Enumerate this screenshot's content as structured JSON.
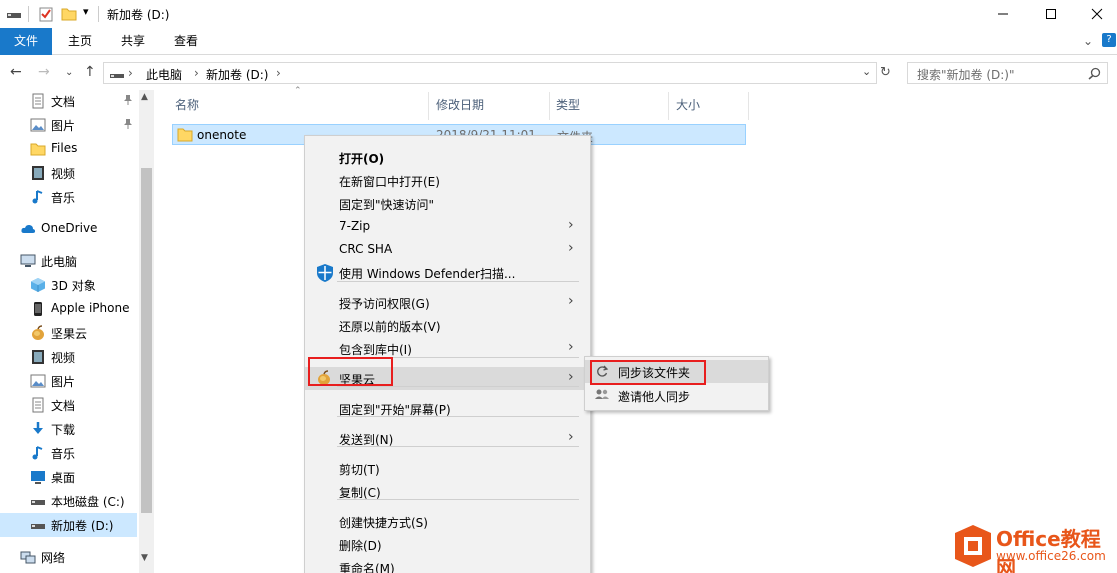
{
  "window": {
    "title": "新加卷 (D:)",
    "controls": [
      "minimize",
      "maximize",
      "close"
    ]
  },
  "ribbon": {
    "tabs": [
      "文件",
      "主页",
      "共享",
      "查看"
    ]
  },
  "address": {
    "crumbs": [
      "此电脑",
      "新加卷 (D:)"
    ],
    "search_placeholder": "搜索\"新加卷 (D:)\""
  },
  "sidebar": {
    "items": [
      {
        "label": "文档",
        "icon": "document-icon",
        "pinned": true
      },
      {
        "label": "图片",
        "icon": "picture-icon",
        "pinned": true
      },
      {
        "label": "Files",
        "icon": "folder-icon"
      },
      {
        "label": "视频",
        "icon": "video-icon"
      },
      {
        "label": "音乐",
        "icon": "music-icon"
      },
      {
        "label": "OneDrive",
        "icon": "cloud-icon"
      },
      {
        "label": "此电脑",
        "icon": "computer-icon"
      },
      {
        "label": "3D 对象",
        "icon": "cube-icon"
      },
      {
        "label": "Apple iPhone",
        "icon": "phone-icon"
      },
      {
        "label": "坚果云",
        "icon": "nut-icon"
      },
      {
        "label": "视频",
        "icon": "video-icon"
      },
      {
        "label": "图片",
        "icon": "picture-icon"
      },
      {
        "label": "文档",
        "icon": "document-icon"
      },
      {
        "label": "下载",
        "icon": "download-icon"
      },
      {
        "label": "音乐",
        "icon": "music-icon"
      },
      {
        "label": "桌面",
        "icon": "desktop-icon"
      },
      {
        "label": "本地磁盘 (C:)",
        "icon": "drive-icon"
      },
      {
        "label": "新加卷 (D:)",
        "icon": "drive-icon",
        "selected": true
      },
      {
        "label": "网络",
        "icon": "network-icon"
      }
    ]
  },
  "content": {
    "columns": [
      "名称",
      "修改日期",
      "类型",
      "大小"
    ],
    "files": [
      {
        "name": "onenote",
        "date": "2018/9/21 11:01",
        "type": "文件夹"
      }
    ]
  },
  "context_menu": {
    "items": [
      {
        "label": "打开(O)",
        "bold": true
      },
      {
        "label": "在新窗口中打开(E)"
      },
      {
        "label": "固定到\"快速访问\""
      },
      {
        "label": "7-Zip",
        "submenu": true
      },
      {
        "label": "CRC SHA",
        "submenu": true
      },
      {
        "label": "使用 Windows Defender扫描...",
        "icon": "shield-icon"
      },
      {
        "label": "授予访问权限(G)",
        "submenu": true
      },
      {
        "label": "还原以前的版本(V)"
      },
      {
        "label": "包含到库中(I)",
        "submenu": true
      },
      {
        "label": "坚果云",
        "submenu": true,
        "icon": "nut-icon",
        "highlighted": true
      },
      {
        "label": "固定到\"开始\"屏幕(P)"
      },
      {
        "label": "发送到(N)",
        "submenu": true
      },
      {
        "label": "剪切(T)"
      },
      {
        "label": "复制(C)"
      },
      {
        "label": "创建快捷方式(S)"
      },
      {
        "label": "删除(D)"
      },
      {
        "label": "重命名(M)"
      }
    ]
  },
  "submenu": {
    "items": [
      {
        "label": "同步该文件夹",
        "icon": "sync-icon"
      },
      {
        "label": "邀请他人同步",
        "icon": "people-icon"
      }
    ]
  },
  "watermark": {
    "brand": "Office教程网",
    "url": "www.office26.com"
  },
  "colors": {
    "accent": "#1979ca",
    "selection": "#cce8ff",
    "highlight_box": "#e81e1e",
    "watermark": "#e8561a"
  }
}
